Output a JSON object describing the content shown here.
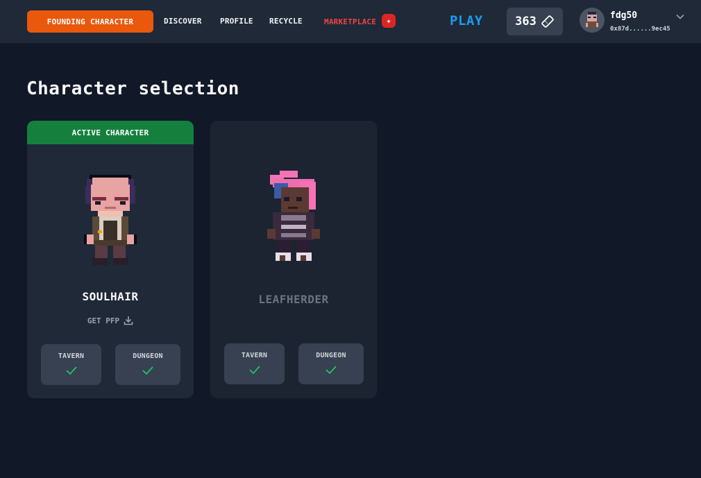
{
  "nav": {
    "founding_label": "FOUNDING CHARACTER",
    "discover": "DISCOVER",
    "profile": "PROFILE",
    "recycle": "RECYCLE",
    "marketplace": "MARKETPLACE",
    "marketplace_icon": "sparkle-icon",
    "play": "PLAY",
    "token_count": "363",
    "token_icon": "ticket-icon",
    "username": "fdg50",
    "wallet": "0x87d......9ec45",
    "colors": {
      "founding": "#ea580c",
      "play": "#1d9bf0",
      "marketplace": "#ef4444"
    }
  },
  "page": {
    "title": "Character selection"
  },
  "characters": [
    {
      "active_label": "ACTIVE CHARACTER",
      "name": "SOULHAIR",
      "pfp_label": "GET PFP",
      "tavern_label": "TAVERN",
      "dungeon_label": "DUNGEON",
      "active": true
    },
    {
      "name": "LEAFHERDER",
      "tavern_label": "TAVERN",
      "dungeon_label": "DUNGEON",
      "active": false
    }
  ]
}
